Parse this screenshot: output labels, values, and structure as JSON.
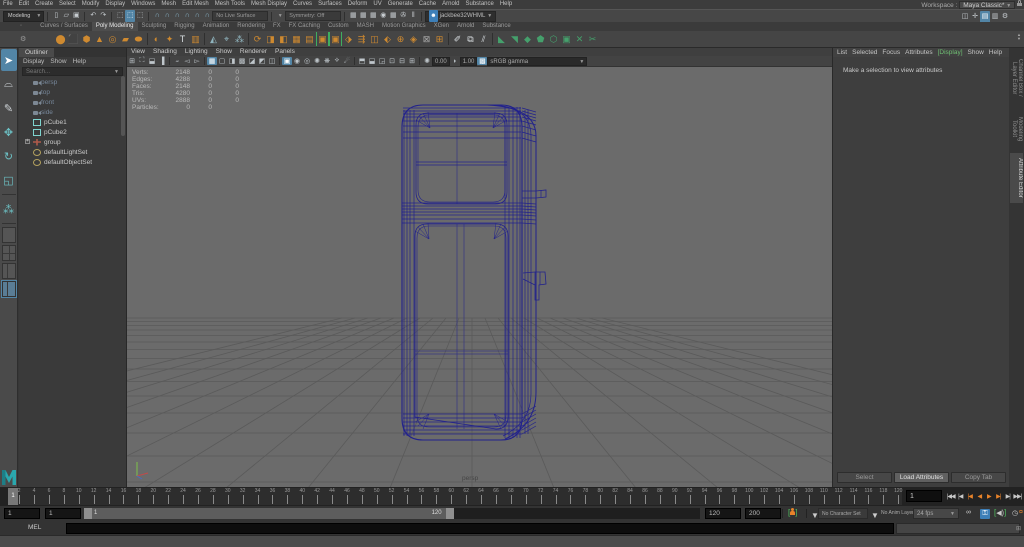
{
  "menubar": {
    "items": [
      "File",
      "Edit",
      "Create",
      "Select",
      "Modify",
      "Display",
      "Windows",
      "Mesh",
      "Edit Mesh",
      "Mesh Tools",
      "Mesh Display",
      "Curves",
      "Surfaces",
      "Deform",
      "UV",
      "Generate",
      "Cache",
      "Arnold",
      "Substance",
      "Help"
    ],
    "workspace_label": "Workspace :",
    "workspace_value": "Maya Classic*"
  },
  "statusline": {
    "mode": "Modeling",
    "no_live_surface": "No Live Surface",
    "symmetry": "Symmetry: Off",
    "account": "jackbee32WHML"
  },
  "shelf": {
    "active_tab": "Poly Modeling",
    "tabs": [
      "Curves / Surfaces",
      "Poly Modeling",
      "Sculpting",
      "Rigging",
      "Animation",
      "Rendering",
      "FX",
      "FX Caching",
      "Custom",
      "MASH",
      "Motion Graphics",
      "XGen",
      "Arnold",
      "Substance"
    ],
    "icons": [
      [
        "poly-sphere",
        "⬤",
        "o"
      ],
      [
        "poly-cube",
        "⬛",
        "o"
      ],
      [
        "poly-cylinder",
        "⬢",
        "o"
      ],
      [
        "poly-cone",
        "▲",
        "o"
      ],
      [
        "poly-torus",
        "◎",
        "o"
      ],
      [
        "poly-plane",
        "▰",
        "o"
      ],
      [
        "poly-disc",
        "⬬",
        "o"
      ],
      [
        "sep",
        "",
        ""
      ],
      [
        "platonic-solid",
        "◐",
        "o"
      ],
      [
        "super-ellipse",
        "✦",
        "o"
      ],
      [
        "poly-type",
        "T",
        "w"
      ],
      [
        "svg-tool",
        "▥",
        "o"
      ],
      [
        "sep",
        "",
        ""
      ],
      [
        "sculpt-transfer",
        "◭",
        "t"
      ],
      [
        "sculpt-objects",
        "⌖",
        "t"
      ],
      [
        "sculpt-pool",
        "⁂",
        "t"
      ],
      [
        "sep",
        "",
        ""
      ],
      [
        "smooth",
        "⟳",
        "o"
      ],
      [
        "combine",
        "◨",
        "o"
      ],
      [
        "separate",
        "◧",
        "o"
      ],
      [
        "boolean-union",
        "▦",
        "o"
      ],
      [
        "boolean-difference",
        "▤",
        "o"
      ],
      [
        "extrude",
        "▣",
        "o",
        "br"
      ],
      [
        "bevel",
        "▣",
        "o",
        "br"
      ],
      [
        "bridge",
        "⬗",
        "o"
      ],
      [
        "project-curve",
        "⇶",
        "o"
      ],
      [
        "split",
        "◫",
        "o"
      ],
      [
        "merge-verts",
        "⬖",
        "o"
      ],
      [
        "mirror",
        "⊕",
        "o"
      ],
      [
        "crease",
        "◈",
        "o"
      ],
      [
        "reduce",
        "⊠",
        "g"
      ],
      [
        "add-divisions",
        "⊞",
        "o"
      ],
      [
        "sep",
        "",
        ""
      ],
      [
        "multi-cut",
        "✐",
        "w"
      ],
      [
        "target-weld",
        "⧉",
        "w"
      ],
      [
        "connect",
        "⫽",
        "w"
      ],
      [
        "sep",
        "",
        ""
      ],
      [
        "quad-draw",
        "◣",
        "gr"
      ],
      [
        "make-live",
        "◥",
        "gr"
      ],
      [
        "center-pivot",
        "◆",
        "gr"
      ],
      [
        "freeze-transform",
        "⬟",
        "gr"
      ],
      [
        "delete-history",
        "⬡",
        "gr"
      ],
      [
        "bake-pivot",
        "▣",
        "gr"
      ],
      [
        "symmetry-cut",
        "✕",
        "gr"
      ],
      [
        "mirror-cut",
        "✂",
        "gr"
      ]
    ]
  },
  "toolbox": {
    "tools": [
      {
        "name": "select-tool",
        "g": "➤",
        "cls": "sel"
      },
      {
        "name": "lasso-tool",
        "g": "⌓",
        "cls": ""
      },
      {
        "name": "paint-select-tool",
        "g": "✎",
        "cls": ""
      },
      {
        "name": "move-tool",
        "g": "✥",
        "cls": "teal"
      },
      {
        "name": "rotate-tool",
        "g": "↻",
        "cls": "teal"
      },
      {
        "name": "scale-tool",
        "g": "◱",
        "cls": "teal"
      },
      {
        "name": "snap-tool",
        "g": "⁂",
        "cls": "teal"
      }
    ]
  },
  "outliner": {
    "title": "Outliner",
    "menus": [
      "Display",
      "Show",
      "Help"
    ],
    "search_placeholder": "Search...",
    "items": [
      {
        "label": "persp",
        "icon": "camera",
        "dim": true
      },
      {
        "label": "top",
        "icon": "camera",
        "dim": true
      },
      {
        "label": "front",
        "icon": "camera",
        "dim": true
      },
      {
        "label": "side",
        "icon": "camera",
        "dim": true
      },
      {
        "label": "pCube1",
        "icon": "mesh",
        "dim": false
      },
      {
        "label": "pCube2",
        "icon": "mesh",
        "dim": false
      },
      {
        "label": "group",
        "icon": "group",
        "dim": false,
        "expander": true
      },
      {
        "label": "defaultLightSet",
        "icon": "set",
        "dim": false
      },
      {
        "label": "defaultObjectSet",
        "icon": "set",
        "dim": false
      }
    ]
  },
  "viewport": {
    "menus": [
      "View",
      "Shading",
      "Lighting",
      "Show",
      "Renderer",
      "Panels"
    ],
    "exposure": "0.00",
    "gamma": "1.00",
    "view_transform": "sRGB gamma",
    "camera_label": "persp",
    "hud_rows": [
      {
        "label": "Verts:",
        "v1": "2148",
        "v2": "0",
        "v3": "0"
      },
      {
        "label": "Edges:",
        "v1": "4288",
        "v2": "0",
        "v3": "0"
      },
      {
        "label": "Faces:",
        "v1": "2148",
        "v2": "0",
        "v3": "0"
      },
      {
        "label": "Tris:",
        "v1": "4280",
        "v2": "0",
        "v3": "0"
      },
      {
        "label": "UVs:",
        "v1": "2888",
        "v2": "0",
        "v3": "0"
      },
      {
        "label": "Particles:",
        "v1": "0",
        "v2": "0",
        "v3": ""
      }
    ]
  },
  "attribute_editor": {
    "menus": [
      "List",
      "Selected",
      "Focus",
      "Attributes",
      "Display",
      "Show",
      "Help"
    ],
    "highlight_menu": "Display",
    "message": "Make a selection to view attributes",
    "buttons": [
      "Select",
      "Load Attributes",
      "Copy Tab"
    ],
    "active_button": "Load Attributes"
  },
  "right_tabs": [
    {
      "label": "Channel Box / Layer Editor",
      "active": false
    },
    {
      "label": "Modeling Toolkit",
      "active": false
    },
    {
      "label": "Attribute Editor",
      "active": true
    }
  ],
  "timeline": {
    "start": 1,
    "end": 120,
    "label_step": 2,
    "current": "1"
  },
  "range_bar": {
    "anim_start": "1",
    "play_start": "1",
    "play_end": "120",
    "anim_end": "200",
    "bar_start": "1",
    "bar_end": "120",
    "character_set": "No Character Set",
    "anim_layer": "No Anim Layer",
    "fps": "24 fps"
  },
  "command_line": {
    "label": "MEL"
  }
}
